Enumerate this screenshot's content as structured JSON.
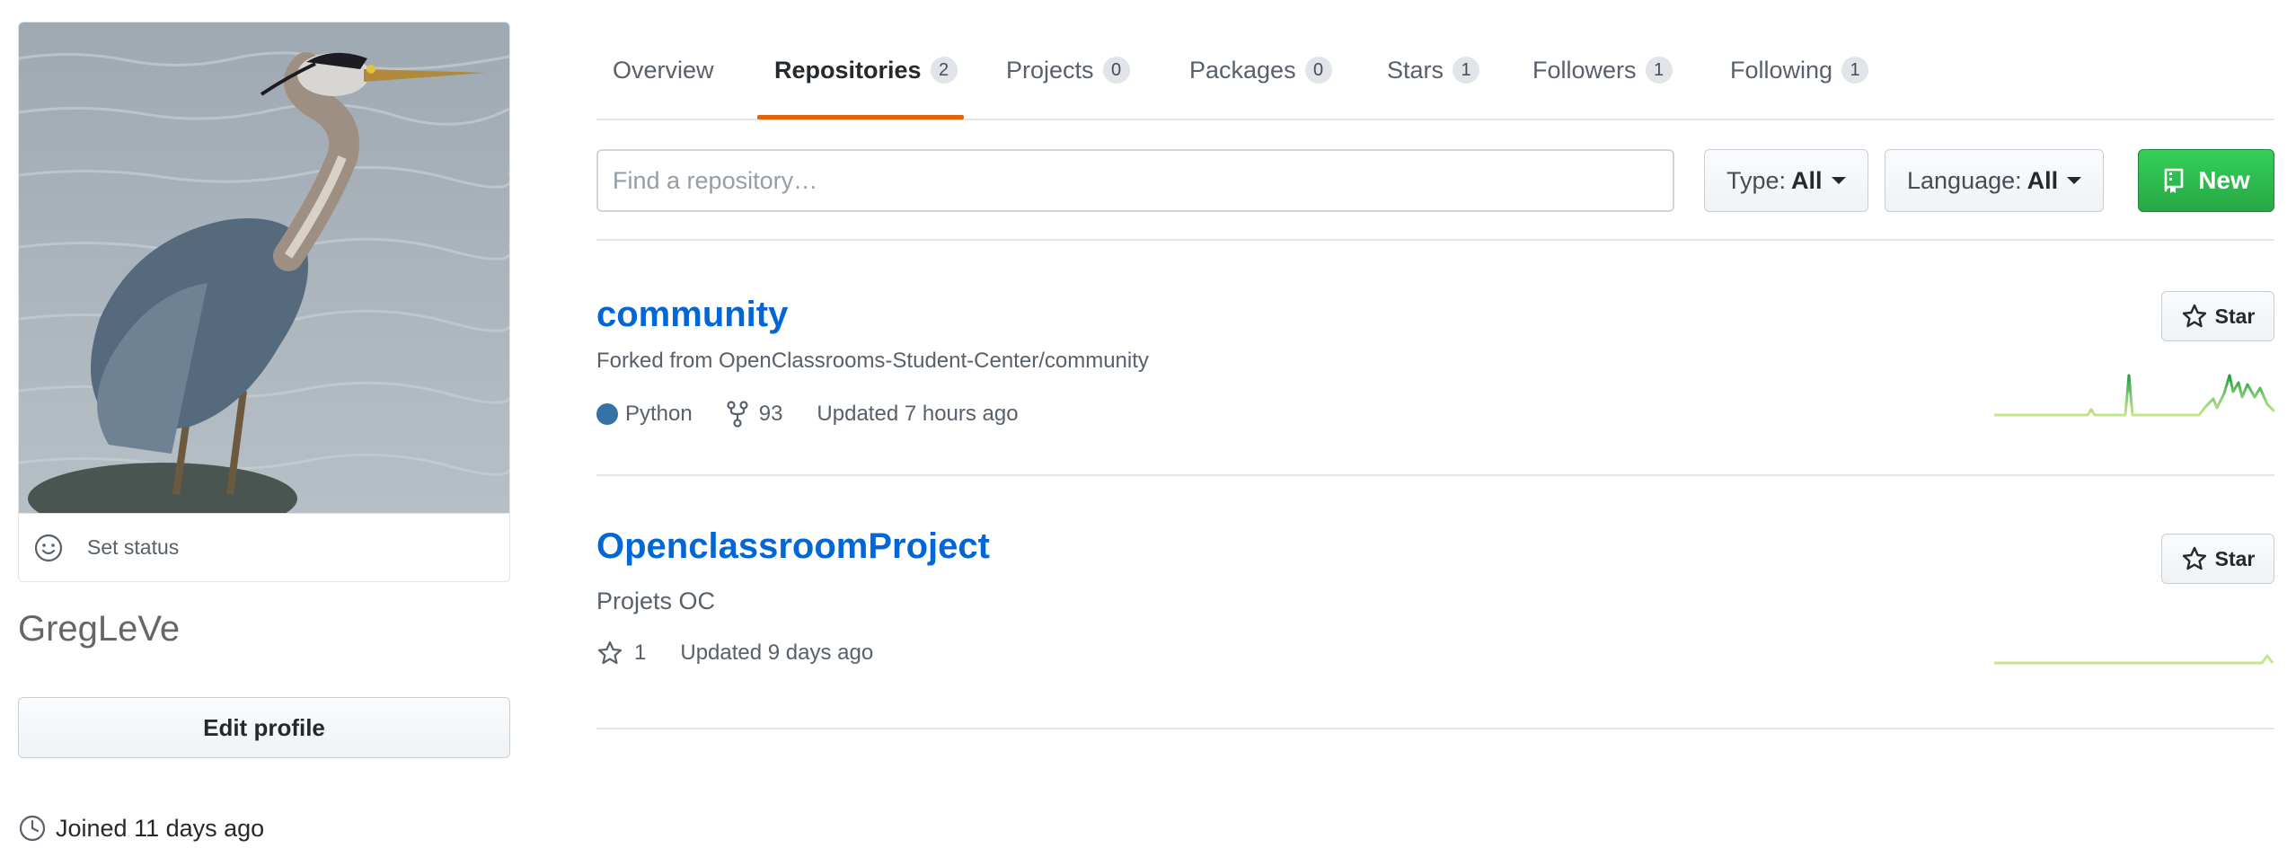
{
  "profile": {
    "username": "GregLeVe",
    "set_status_label": "Set status",
    "edit_profile_label": "Edit profile",
    "joined_label": "Joined 11 days ago"
  },
  "tabs": [
    {
      "label": "Overview",
      "count": null,
      "active": false
    },
    {
      "label": "Repositories",
      "count": "2",
      "active": true
    },
    {
      "label": "Projects",
      "count": "0",
      "active": false
    },
    {
      "label": "Packages",
      "count": "0",
      "active": false
    },
    {
      "label": "Stars",
      "count": "1",
      "active": false
    },
    {
      "label": "Followers",
      "count": "1",
      "active": false
    },
    {
      "label": "Following",
      "count": "1",
      "active": false
    }
  ],
  "filters": {
    "search_placeholder": "Find a repository…",
    "search_value": "",
    "type_label": "Type:",
    "type_value": "All",
    "language_label": "Language:",
    "language_value": "All",
    "new_label": "New"
  },
  "repos": [
    {
      "name": "community",
      "description": "Forked from OpenClassrooms-Student-Center/community",
      "language": "Python",
      "language_color": "#3572a5",
      "forks": "93",
      "updated": "Updated 7 hours ago",
      "star_label": "Star"
    },
    {
      "name": "OpenclassroomProject",
      "description": "Projets OC",
      "stars": "1",
      "updated": "Updated 9 days ago",
      "star_label": "Star"
    }
  ],
  "colors": {
    "link": "#0366d6",
    "active_tab_underline": "#e36209",
    "new_button": "#28a745",
    "sparkline_low": "#c6e48b",
    "sparkline_high": "#239a3b"
  }
}
